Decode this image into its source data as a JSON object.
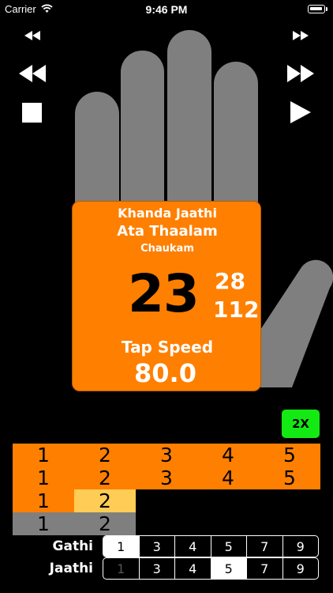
{
  "status_bar": {
    "carrier": "Carrier",
    "time": "9:46 PM"
  },
  "palm": {
    "jaathi": "Khanda Jaathi",
    "thaalam": "Ata Thaalam",
    "nadai": "Chaukam",
    "beat": "23",
    "sub_top": "28",
    "sub_bottom": "112",
    "tap_label": "Tap Speed",
    "tap_value": "80.0"
  },
  "speed_button": "2X",
  "colors": {
    "orange": "#ff7f00",
    "yellow": "#ffcc55",
    "gray_cell": "#7f7f7f",
    "hand": "#7f7f7f",
    "green": "#13ea13"
  },
  "count_rows": [
    [
      "1",
      "2",
      "3",
      "4",
      "5"
    ],
    [
      "1",
      "2",
      "3",
      "4",
      "5"
    ],
    [
      "1",
      "2"
    ],
    [
      "1",
      "2"
    ]
  ],
  "gathi": {
    "label": "Gathi",
    "options": [
      "1",
      "3",
      "4",
      "5",
      "7",
      "9"
    ],
    "selected": "1"
  },
  "jaathi": {
    "label": "Jaathi",
    "options": [
      "1",
      "3",
      "4",
      "5",
      "7",
      "9"
    ],
    "selected": "5",
    "disabled": "1"
  }
}
